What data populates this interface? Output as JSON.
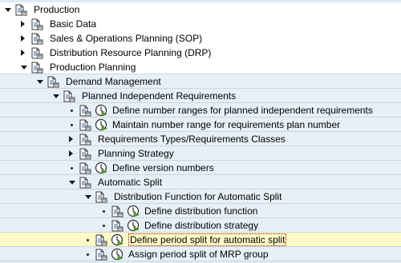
{
  "tree": {
    "rows": [
      {
        "label": "Production",
        "toggle": "down",
        "clock": false,
        "dot": false,
        "level": 0,
        "bg": "white"
      },
      {
        "label": "Basic Data",
        "toggle": "right",
        "clock": false,
        "dot": false,
        "level": 1,
        "bg": "white"
      },
      {
        "label": "Sales & Operations Planning (SOP)",
        "toggle": "right",
        "clock": false,
        "dot": false,
        "level": 1,
        "bg": "white"
      },
      {
        "label": "Distribution Resource Planning (DRP)",
        "toggle": "right",
        "clock": false,
        "dot": false,
        "level": 1,
        "bg": "white"
      },
      {
        "label": "Production Planning",
        "toggle": "down",
        "clock": false,
        "dot": false,
        "level": 1,
        "bg": "white"
      },
      {
        "label": "Demand Management",
        "toggle": "down",
        "clock": false,
        "dot": false,
        "level": 2,
        "bg": "light"
      },
      {
        "label": "Planned Independent Requirements",
        "toggle": "down",
        "clock": false,
        "dot": false,
        "level": 3,
        "bg": "light"
      },
      {
        "label": "Define number ranges for planned independent requirements",
        "toggle": "none",
        "clock": true,
        "dot": true,
        "level": 4,
        "bg": "light"
      },
      {
        "label": "Maintain number range for requirements plan number",
        "toggle": "none",
        "clock": true,
        "dot": true,
        "level": 4,
        "bg": "light"
      },
      {
        "label": "Requirements Types/Requirements Classes",
        "toggle": "right",
        "clock": false,
        "dot": false,
        "level": 4,
        "bg": "light"
      },
      {
        "label": "Planning Strategy",
        "toggle": "right",
        "clock": false,
        "dot": false,
        "level": 4,
        "bg": "light"
      },
      {
        "label": "Define version numbers",
        "toggle": "none",
        "clock": true,
        "dot": true,
        "level": 4,
        "bg": "light"
      },
      {
        "label": "Automatic Split",
        "toggle": "down",
        "clock": false,
        "dot": false,
        "level": 4,
        "bg": "light"
      },
      {
        "label": "Distribution Function for Automatic Split",
        "toggle": "down",
        "clock": false,
        "dot": false,
        "level": 5,
        "bg": "light"
      },
      {
        "label": "Define distribution function",
        "toggle": "none",
        "clock": true,
        "dot": true,
        "level": 6,
        "bg": "light"
      },
      {
        "label": "Define distribution strategy",
        "toggle": "none",
        "clock": true,
        "dot": true,
        "level": 6,
        "bg": "light"
      },
      {
        "label": "Define period split for automatic split",
        "toggle": "none",
        "clock": true,
        "dot": true,
        "level": 5,
        "bg": "selected"
      },
      {
        "label": "Assign period split of MRP group",
        "toggle": "none",
        "clock": true,
        "dot": true,
        "level": 5,
        "bg": "light"
      }
    ]
  },
  "colors": {
    "selected_bg": "#fffbc8",
    "clock_green": "#5aa028",
    "doc_blue": "#4a6fa5"
  },
  "icons": {
    "document": "config-document-icon",
    "execute": "execute-clock-icon",
    "expand": "triangle-right-icon",
    "collapse": "triangle-down-icon"
  }
}
